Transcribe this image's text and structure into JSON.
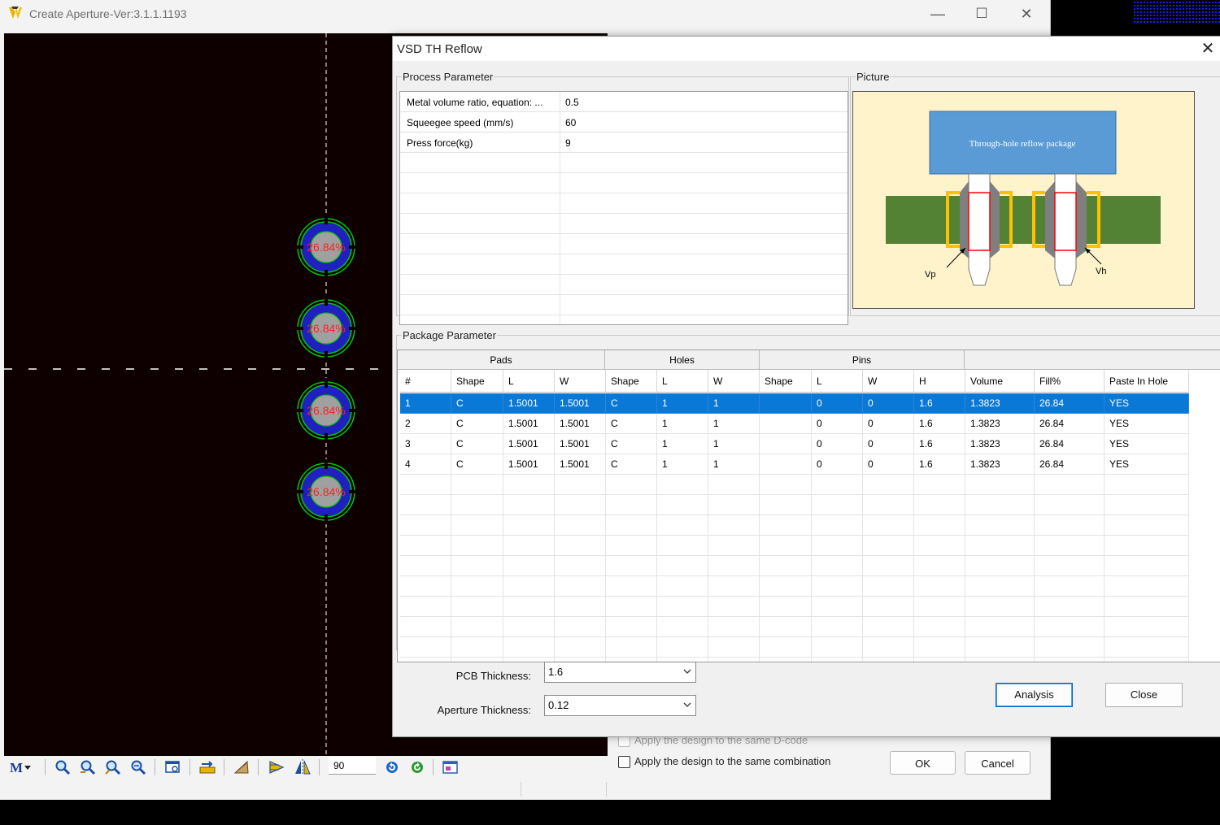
{
  "main_window": {
    "title": "Create Aperture-Ver:3.1.1.1193",
    "controls": {
      "minimize": "—",
      "maximize": "☐",
      "close": "✕"
    }
  },
  "canvas": {
    "pad_labels": [
      "26.84%",
      "26.84%",
      "26.84%",
      "26.84%"
    ],
    "colors": {
      "background": "#0f0000",
      "pad_outer": "#2020c0",
      "pad_inner": "#a0a0a0",
      "ring": "#00c800",
      "label": "#ff2020",
      "crosshair": "#ffffff"
    }
  },
  "toolbar": {
    "menu_letter": "M",
    "angle_value": "90",
    "icons": [
      "mode-icon",
      "zoom-icon",
      "zoom-in-icon",
      "zoom-out-icon",
      "zoom-fit-icon",
      "view-window-icon",
      "measure-icon",
      "edit-icon",
      "align-icon",
      "mirror-icon",
      "rotate-ccw-icon",
      "rotate-cw-icon",
      "layer-window-icon"
    ]
  },
  "main_options": {
    "apply_same_dcode": "Apply the design to the same D-code",
    "apply_same_combination": "Apply the design to the same combination",
    "ok_label": "OK",
    "cancel_label": "Cancel"
  },
  "dialog": {
    "title": "VSD TH Reflow",
    "close_glyph": "✕",
    "process": {
      "legend": "Process Parameter",
      "rows": [
        {
          "name": "Metal volume ratio, equation: ...",
          "value": "0.5"
        },
        {
          "name": "Squeegee speed (mm/s)",
          "value": "60"
        },
        {
          "name": "Press force(kg)",
          "value": "9"
        }
      ]
    },
    "picture": {
      "legend": "Picture",
      "package_label": "Through-hole reflow package",
      "vp_label": "Vp",
      "vh_label": "Vh"
    },
    "package": {
      "legend": "Package Parameter",
      "groups": [
        "Pads",
        "Holes",
        "Pins"
      ],
      "columns": [
        "#",
        "Shape",
        "L",
        "W",
        "Shape",
        "L",
        "W",
        "Shape",
        "L",
        "W",
        "H",
        "Volume",
        "Fill%",
        "Paste In Hole"
      ],
      "rows": [
        [
          "1",
          "C",
          "1.5001",
          "1.5001",
          "C",
          "1",
          "1",
          "",
          "0",
          "0",
          "1.6",
          "1.3823",
          "26.84",
          "YES"
        ],
        [
          "2",
          "C",
          "1.5001",
          "1.5001",
          "C",
          "1",
          "1",
          "",
          "0",
          "0",
          "1.6",
          "1.3823",
          "26.84",
          "YES"
        ],
        [
          "3",
          "C",
          "1.5001",
          "1.5001",
          "C",
          "1",
          "1",
          "",
          "0",
          "0",
          "1.6",
          "1.3823",
          "26.84",
          "YES"
        ],
        [
          "4",
          "C",
          "1.5001",
          "1.5001",
          "C",
          "1",
          "1",
          "",
          "0",
          "0",
          "1.6",
          "1.3823",
          "26.84",
          "YES"
        ]
      ],
      "selected_row": 0
    },
    "pcb_thickness": {
      "label": "PCB Thickness:",
      "value": "1.6"
    },
    "aperture_thickness": {
      "label": "Aperture Thickness:",
      "value": "0.12"
    },
    "analysis_label": "Analysis",
    "close_label": "Close"
  }
}
